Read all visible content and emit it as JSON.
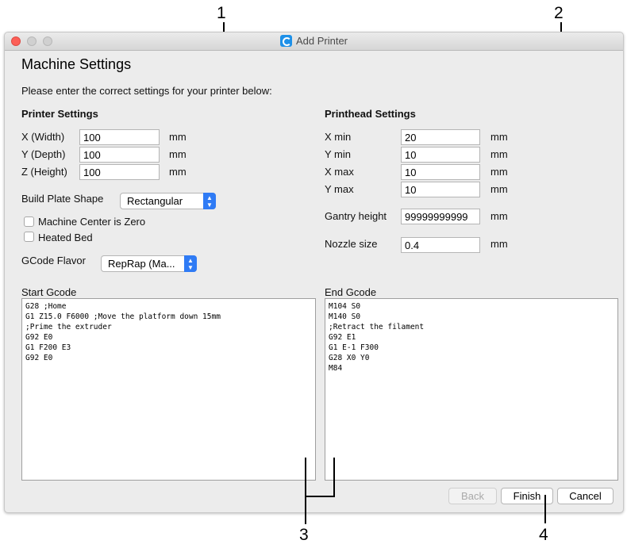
{
  "callouts": [
    "1",
    "2",
    "3",
    "4"
  ],
  "window": {
    "title": "Add Printer"
  },
  "page": {
    "heading": "Machine Settings",
    "subtitle": "Please enter the correct settings for your printer below:"
  },
  "printer_settings": {
    "heading": "Printer Settings",
    "fields": [
      {
        "label": "X (Width)",
        "value": "100",
        "unit": "mm"
      },
      {
        "label": "Y (Depth)",
        "value": "100",
        "unit": "mm"
      },
      {
        "label": "Z (Height)",
        "value": "100",
        "unit": "mm"
      }
    ],
    "build_plate_label": "Build Plate Shape",
    "build_plate_value": "Rectangular",
    "machine_center_label": "Machine Center is Zero",
    "machine_center_checked": false,
    "heated_bed_label": "Heated Bed",
    "heated_bed_checked": false,
    "gcode_flavor_label": "GCode Flavor",
    "gcode_flavor_value": "RepRap (Ma..."
  },
  "printhead_settings": {
    "heading": "Printhead Settings",
    "fields": [
      {
        "label": "X min",
        "value": "20",
        "unit": "mm"
      },
      {
        "label": "Y min",
        "value": "10",
        "unit": "mm"
      },
      {
        "label": "X max",
        "value": "10",
        "unit": "mm"
      },
      {
        "label": "Y max",
        "value": "10",
        "unit": "mm"
      }
    ],
    "gantry_label": "Gantry height",
    "gantry_value": "99999999999",
    "gantry_unit": "mm",
    "nozzle_label": "Nozzle size",
    "nozzle_value": "0.4",
    "nozzle_unit": "mm"
  },
  "start_gcode": {
    "label": "Start Gcode",
    "content": "G28 ;Home\nG1 Z15.0 F6000 ;Move the platform down 15mm\n;Prime the extruder\nG92 E0\nG1 F200 E3\nG92 E0"
  },
  "end_gcode": {
    "label": "End Gcode",
    "content": "M104 S0\nM140 S0\n;Retract the filament\nG92 E1\nG1 E-1 F300\nG28 X0 Y0\nM84"
  },
  "buttons": {
    "back": "Back",
    "finish": "Finish",
    "cancel": "Cancel"
  },
  "colors": {
    "close": "#fc5f57",
    "accent": "#2f7bf5",
    "app_icon": "#1e90e8"
  }
}
